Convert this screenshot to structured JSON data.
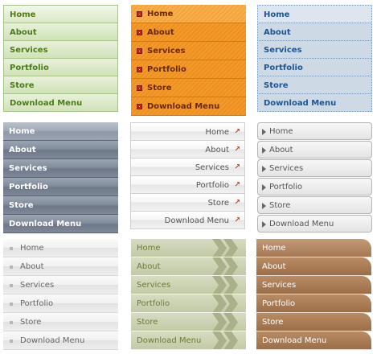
{
  "menus": {
    "green": {
      "items": [
        {
          "label": "Home"
        },
        {
          "label": "About"
        },
        {
          "label": "Services"
        },
        {
          "label": "Portfolio"
        },
        {
          "label": "Store"
        },
        {
          "label": "Download Menu"
        }
      ]
    },
    "orange": {
      "items": [
        {
          "label": "Home"
        },
        {
          "label": "About"
        },
        {
          "label": "Services"
        },
        {
          "label": "Portfolio"
        },
        {
          "label": "Store"
        },
        {
          "label": "Download Menu"
        }
      ]
    },
    "blue": {
      "items": [
        {
          "label": "Home"
        },
        {
          "label": "About"
        },
        {
          "label": "Services"
        },
        {
          "label": "Portfolio"
        },
        {
          "label": "Store"
        },
        {
          "label": "Download Menu"
        }
      ]
    },
    "slate": {
      "items": [
        {
          "label": "Home"
        },
        {
          "label": "About"
        },
        {
          "label": "Services"
        },
        {
          "label": "Portfolio"
        },
        {
          "label": "Store"
        },
        {
          "label": "Download Menu"
        }
      ]
    },
    "glossy": {
      "items": [
        {
          "label": "Home"
        },
        {
          "label": "About"
        },
        {
          "label": "Services"
        },
        {
          "label": "Portfolio"
        },
        {
          "label": "Store"
        },
        {
          "label": "Download Menu"
        }
      ]
    },
    "rounded": {
      "items": [
        {
          "label": "Home"
        },
        {
          "label": "About"
        },
        {
          "label": "Services"
        },
        {
          "label": "Portfolio"
        },
        {
          "label": "Store"
        },
        {
          "label": "Download Menu"
        }
      ]
    },
    "light": {
      "items": [
        {
          "label": "Home"
        },
        {
          "label": "About"
        },
        {
          "label": "Services"
        },
        {
          "label": "Portfolio"
        },
        {
          "label": "Store"
        },
        {
          "label": "Download Menu"
        }
      ]
    },
    "olive": {
      "items": [
        {
          "label": "Home"
        },
        {
          "label": "About"
        },
        {
          "label": "Services"
        },
        {
          "label": "Portfolio"
        },
        {
          "label": "Store"
        },
        {
          "label": "Download Menu"
        }
      ]
    },
    "brown": {
      "items": [
        {
          "label": "Home"
        },
        {
          "label": "About"
        },
        {
          "label": "Services"
        },
        {
          "label": "Portfolio"
        },
        {
          "label": "Store"
        },
        {
          "label": "Download Menu"
        }
      ]
    }
  },
  "icons": {
    "orange_bullet": "square-bullet-icon",
    "glossy_arrow": "arrow-up-right-icon",
    "rounded_arrow": "triangle-right-icon",
    "light_bullet": "square-bullet-icon",
    "olive_chevron": "double-chevron-right-icon"
  },
  "colors": {
    "green_text": "#4f7a1c",
    "orange_bg": "#f39a2c",
    "blue_text": "#1f5590",
    "slate_bg": "#828d9c",
    "glossy_arrow": "#d93a18",
    "olive_text": "#6b7a3a",
    "brown_bg": "#a67853"
  }
}
